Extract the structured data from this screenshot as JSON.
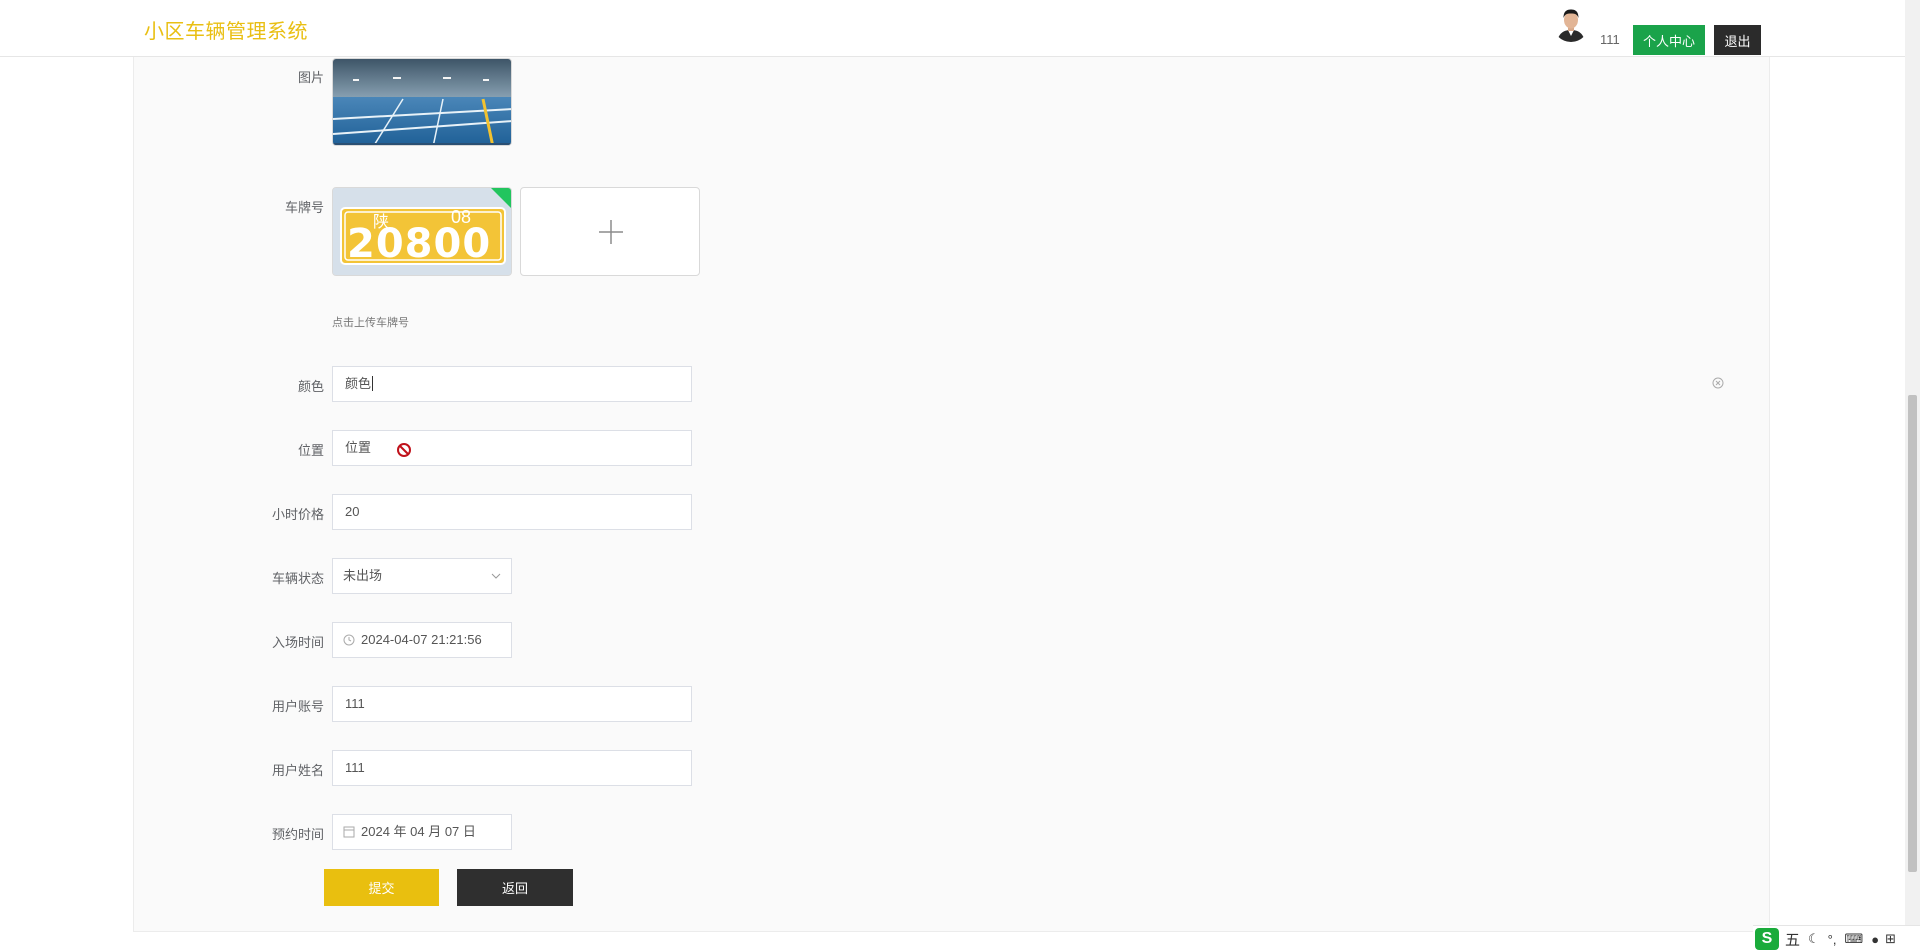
{
  "header": {
    "brand": "小区车辆管理系统",
    "username": "111",
    "profile_button": "个人中心",
    "logout_button": "退出"
  },
  "form": {
    "image_label": "图片",
    "plate_label": "车牌号",
    "plate_image_text": {
      "province": "陕",
      "code": "08",
      "number": "20800"
    },
    "upload_hint": "点击上传车牌号",
    "color_label": "颜色",
    "color_value": "颜色",
    "location_label": "位置",
    "location_value": "位置",
    "price_label": "小时价格",
    "price_value": "20",
    "status_label": "车辆状态",
    "status_value": "未出场",
    "entry_time_label": "入场时间",
    "entry_time_value": "2024-04-07 21:21:56",
    "account_label": "用户账号",
    "account_value": "111",
    "name_label": "用户姓名",
    "name_value": "111",
    "reserve_time_label": "预约时间",
    "reserve_time_value": "2024 年 04 月 07 日",
    "submit_button": "提交",
    "back_button": "返回"
  },
  "ime": {
    "logo": "S",
    "mode": "五",
    "items": [
      "moon-icon",
      "punctuation-icon",
      "keyboard-icon",
      "user-icon",
      "grid-icon"
    ]
  },
  "colors": {
    "brand": "#e9bf13",
    "profile_button": "#1aa34a",
    "logout_button": "#2b2b2b",
    "submit_button": "#e9bf0f",
    "back_button": "#2f2f2f",
    "plate_yellow": "#f3c437",
    "ime_green": "#1aab3b"
  }
}
